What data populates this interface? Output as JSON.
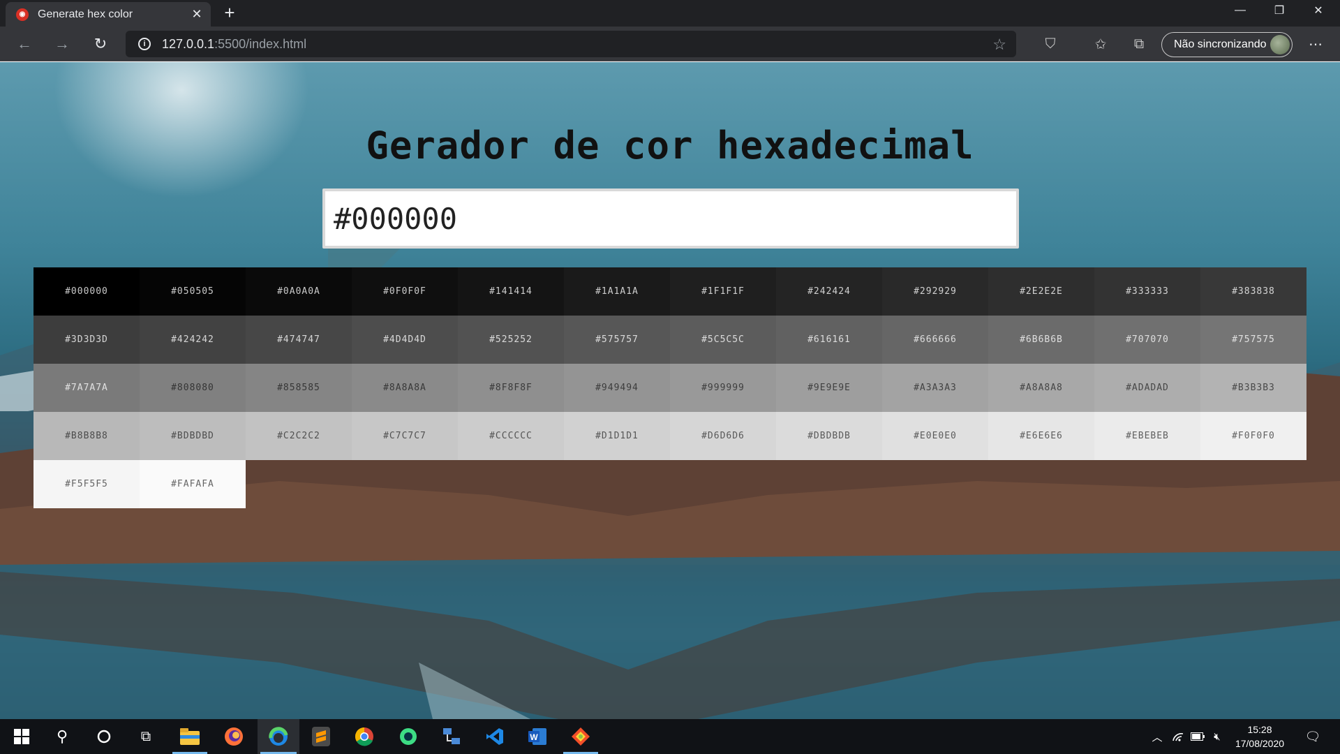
{
  "browser": {
    "tab_title": "Generate hex color",
    "url_host": "127.0.0.1",
    "url_rest": ":5500/index.html",
    "sync_label": "Não sincronizando"
  },
  "page": {
    "heading": "Gerador de cor hexadecimal",
    "input_value": "#000000",
    "colors": [
      "#000000",
      "#050505",
      "#0A0A0A",
      "#0F0F0F",
      "#141414",
      "#1A1A1A",
      "#1F1F1F",
      "#242424",
      "#292929",
      "#2E2E2E",
      "#333333",
      "#383838",
      "#3D3D3D",
      "#424242",
      "#474747",
      "#4D4D4D",
      "#525252",
      "#575757",
      "#5C5C5C",
      "#616161",
      "#666666",
      "#6B6B6B",
      "#707070",
      "#757575",
      "#7A7A7A",
      "#808080",
      "#858585",
      "#8A8A8A",
      "#8F8F8F",
      "#949494",
      "#999999",
      "#9E9E9E",
      "#A3A3A3",
      "#A8A8A8",
      "#ADADAD",
      "#B3B3B3",
      "#B8B8B8",
      "#BDBDBD",
      "#C2C2C2",
      "#C7C7C7",
      "#CCCCCC",
      "#D1D1D1",
      "#D6D6D6",
      "#DBDBDB",
      "#E0E0E0",
      "#E6E6E6",
      "#EBEBEB",
      "#F0F0F0",
      "#F5F5F5",
      "#FAFAFA"
    ]
  },
  "taskbar": {
    "time": "15:28",
    "date": "17/08/2020",
    "apps": [
      "windows-start",
      "search",
      "cortana",
      "task-view",
      "file-explorer",
      "firefox",
      "edge",
      "sublime-text",
      "chrome",
      "android-studio",
      "network-tool",
      "vscode",
      "word",
      "git-kraken"
    ]
  }
}
